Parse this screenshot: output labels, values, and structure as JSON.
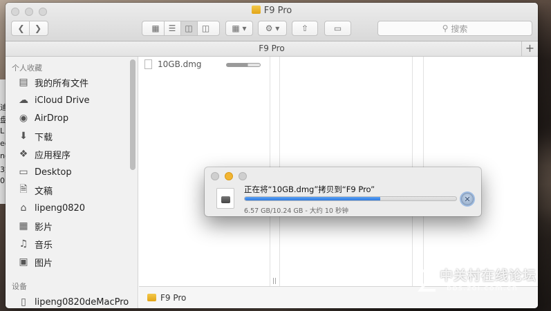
{
  "window": {
    "title": "F9 Pro",
    "path_title": "F9 Pro",
    "search_placeholder": "搜索"
  },
  "toolbar": {
    "back_icon": "chevron-left-icon",
    "forward_icon": "chevron-right-icon",
    "view_icons": [
      "icon-view-icon",
      "list-view-icon",
      "column-view-icon",
      "cover-flow-icon"
    ],
    "active_view": "column-view-icon",
    "arrange_icon": "arrange-icon",
    "action_icon": "gear-icon",
    "share_icon": "share-icon",
    "tag_icon": "tag-icon"
  },
  "sidebar": {
    "favorites_header": "个人收藏",
    "items": [
      {
        "label": "我的所有文件",
        "icon": "all-files-icon"
      },
      {
        "label": "iCloud Drive",
        "icon": "cloud-icon"
      },
      {
        "label": "AirDrop",
        "icon": "airdrop-icon"
      },
      {
        "label": "下载",
        "icon": "download-icon"
      },
      {
        "label": "应用程序",
        "icon": "applications-icon"
      },
      {
        "label": "Desktop",
        "icon": "desktop-icon"
      },
      {
        "label": "文稿",
        "icon": "documents-icon"
      },
      {
        "label": "lipeng0820",
        "icon": "home-icon"
      },
      {
        "label": "影片",
        "icon": "movies-icon"
      },
      {
        "label": "音乐",
        "icon": "music-icon"
      },
      {
        "label": "图片",
        "icon": "pictures-icon"
      }
    ],
    "devices_header": "设备",
    "devices": [
      {
        "label": "lipeng0820deMacPro",
        "icon": "computer-icon"
      }
    ]
  },
  "content": {
    "file_name": "10GB.dmg",
    "file_progress": 0.64,
    "bottom_path": "F9 Pro"
  },
  "copy_dialog": {
    "title": "正在将“10GB.dmg”拷贝到“F9 Pro”",
    "status": "6.57 GB/10.24 GB - 大约 10 秒钟",
    "progress": 0.642
  },
  "background_window": {
    "fragments": [
      "迪",
      "盘",
      "L",
      "ed",
      "no",
      "3文",
      "0"
    ]
  },
  "watermark": {
    "text": "中关村在线论坛",
    "url": "bbs.zol.com.cn"
  }
}
